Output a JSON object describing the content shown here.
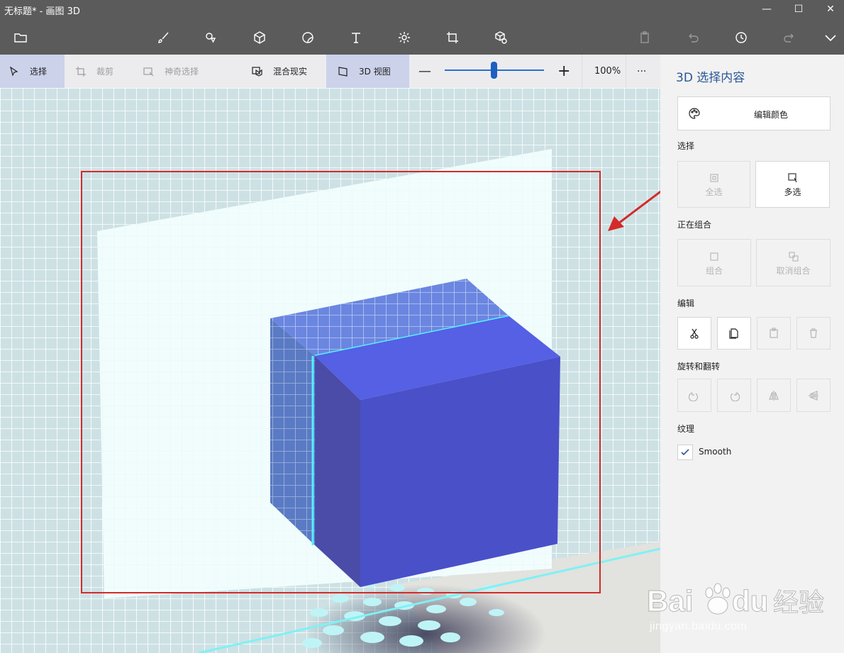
{
  "window": {
    "title": "无标题* - 画图 3D",
    "controls": {
      "minimize": "—",
      "maximize": "☐",
      "close": "✕"
    }
  },
  "toolbar": {
    "tools": [
      {
        "name": "open-icon"
      },
      {
        "name": "brush-icon"
      },
      {
        "name": "2d-shapes-icon"
      },
      {
        "name": "3d-shapes-icon"
      },
      {
        "name": "stickers-icon"
      },
      {
        "name": "text-icon"
      },
      {
        "name": "effects-icon"
      },
      {
        "name": "canvas-icon"
      },
      {
        "name": "3d-library-icon"
      }
    ],
    "right": [
      {
        "name": "paste-icon"
      },
      {
        "name": "undo-icon"
      },
      {
        "name": "history-icon"
      },
      {
        "name": "redo-icon"
      },
      {
        "name": "expand-icon"
      }
    ]
  },
  "subtoolbar": {
    "select": "选择",
    "crop": "裁剪",
    "magic_select": "神奇选择",
    "mixed_reality": "混合现实",
    "view_3d": "3D 视图",
    "zoom_minus": "—",
    "zoom_plus": "+",
    "zoom_level": "100%",
    "more": "···"
  },
  "panel": {
    "title": "3D 选择内容",
    "edit_color": "编辑颜色",
    "select_section": "选择",
    "select_all": "全选",
    "multi_select": "多选",
    "grouping_section": "正在组合",
    "group": "组合",
    "ungroup": "取消组合",
    "edit_section": "编辑",
    "rotate_section": "旋转和翻转",
    "texture_section": "纹理",
    "smooth": "Smooth",
    "smooth_checked": true
  },
  "colors": {
    "title_bar": "#5b5b5b",
    "cube_front": "#4a50c8",
    "cube_top": "#5560e4",
    "cube_back": "#6a86e0",
    "annotation": "#d42a2a",
    "panel_title": "#2b5797"
  },
  "watermark": {
    "logo": "Bai du 经验",
    "url": "jingyan.baidu.com"
  }
}
